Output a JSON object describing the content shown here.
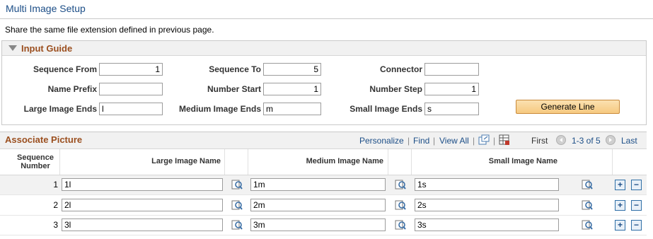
{
  "page": {
    "title": "Multi Image Setup",
    "instructions": "Share the same file extension defined in previous page."
  },
  "input_guide": {
    "title": "Input Guide",
    "fields": {
      "sequence_from": {
        "label": "Sequence From",
        "value": "1"
      },
      "sequence_to": {
        "label": "Sequence To",
        "value": "5"
      },
      "connector": {
        "label": "Connector",
        "value": ""
      },
      "name_prefix": {
        "label": "Name Prefix",
        "value": ""
      },
      "number_start": {
        "label": "Number Start",
        "value": "1"
      },
      "number_step": {
        "label": "Number Step",
        "value": "1"
      },
      "large_image_ends": {
        "label": "Large Image Ends",
        "value": "l"
      },
      "medium_image_ends": {
        "label": "Medium Image Ends",
        "value": "m"
      },
      "small_image_ends": {
        "label": "Small Image Ends",
        "value": "s"
      }
    },
    "generate_button": "Generate Line"
  },
  "grid": {
    "title": "Associate Picture",
    "nav": {
      "personalize": "Personalize",
      "find": "Find",
      "view_all": "View All",
      "first": "First",
      "range": "1-3 of 5",
      "last": "Last",
      "separator": "|"
    },
    "columns": {
      "sequence": "Sequence Number",
      "large": "Large Image Name",
      "medium": "Medium Image Name",
      "small": "Small Image Name"
    },
    "rows": [
      {
        "seq": "1",
        "large": "1l",
        "medium": "1m",
        "small": "1s"
      },
      {
        "seq": "2",
        "large": "2l",
        "medium": "2m",
        "small": "2s"
      },
      {
        "seq": "3",
        "large": "3l",
        "medium": "3m",
        "small": "3s"
      }
    ],
    "add_symbol": "+",
    "remove_symbol": "−"
  },
  "colors": {
    "section_title": "#9b4f1f",
    "link": "#1c4e87",
    "button_fill": "#f6c980"
  }
}
